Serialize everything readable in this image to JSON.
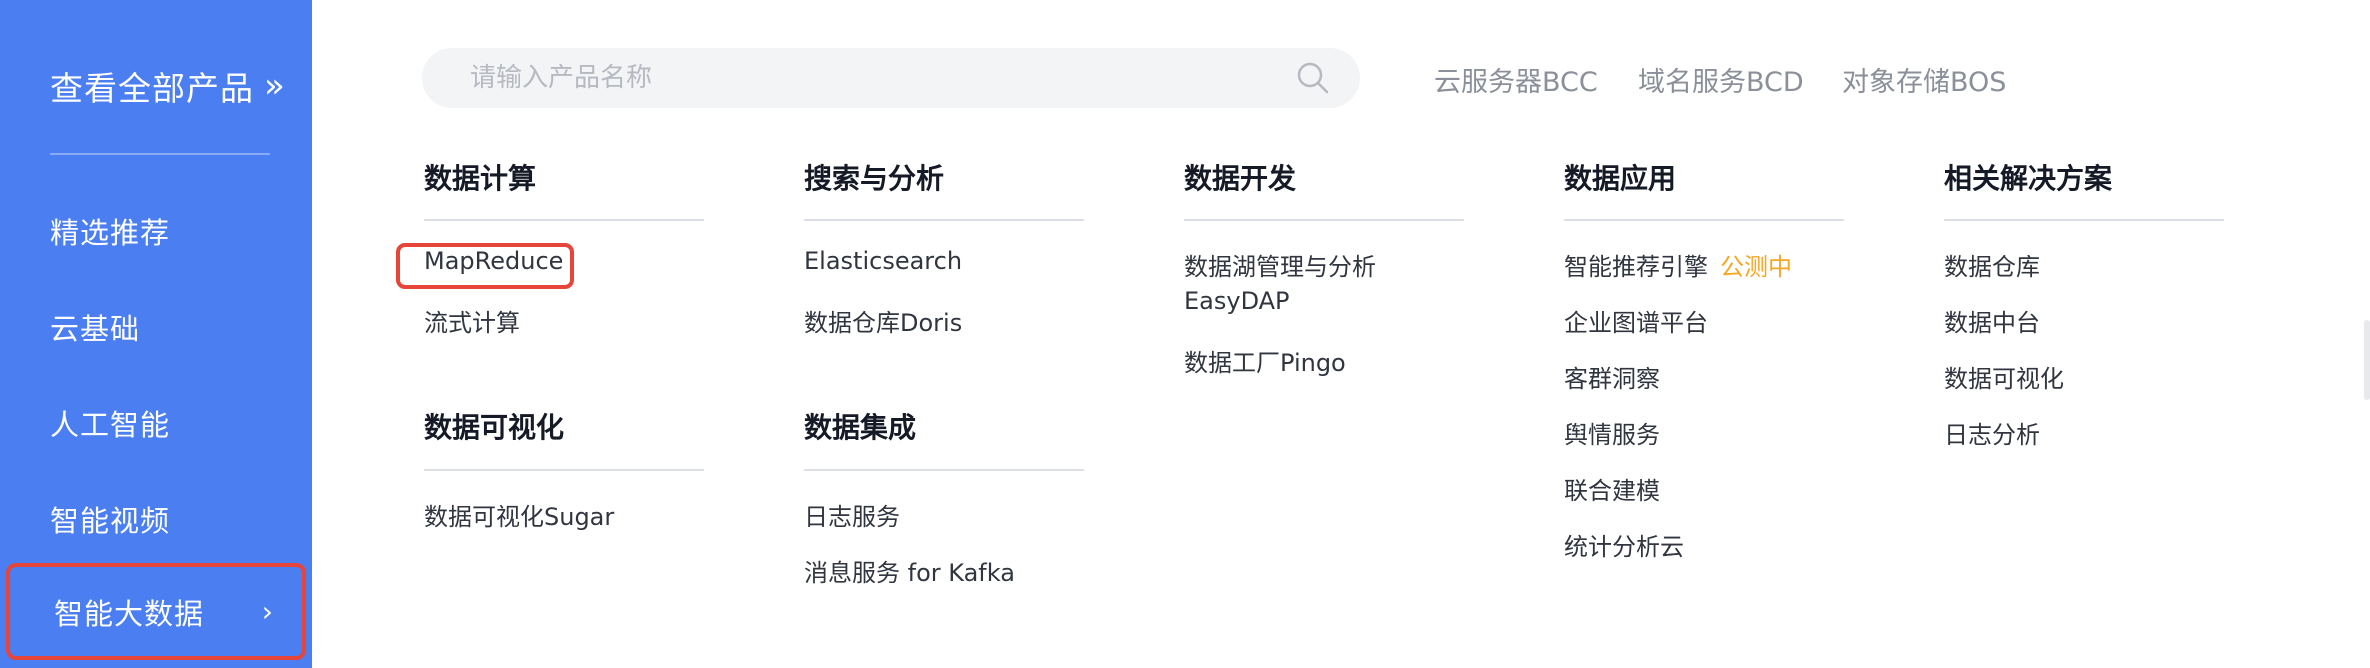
{
  "sidebar": {
    "all_products": "查看全部产品",
    "items": [
      {
        "label": "精选推荐"
      },
      {
        "label": "云基础"
      },
      {
        "label": "人工智能"
      },
      {
        "label": "智能视频"
      },
      {
        "label": "智能大数据"
      }
    ],
    "active_index": 4
  },
  "search": {
    "placeholder": "请输入产品名称",
    "value": ""
  },
  "quick_links": [
    "云服务器BCC",
    "域名服务BCD",
    "对象存储BOS"
  ],
  "categories": [
    {
      "title": "数据计算",
      "items": [
        "MapReduce",
        "流式计算"
      ]
    },
    {
      "title": "搜索与分析",
      "items": [
        "Elasticsearch",
        "数据仓库Doris"
      ]
    },
    {
      "title": "数据开发",
      "items": [
        "数据湖管理与分析",
        "EasyDAP",
        "数据工厂Pingo"
      ]
    },
    {
      "title": "数据应用",
      "items": [
        "智能推荐引擎",
        "企业图谱平台",
        "客群洞察",
        "舆情服务",
        "联合建模",
        "统计分析云"
      ],
      "badge": "公测中"
    },
    {
      "title": "相关解决方案",
      "items": [
        "数据仓库",
        "数据中台",
        "数据可视化",
        "日志分析"
      ]
    },
    {
      "title": "数据可视化",
      "items": [
        "数据可视化Sugar"
      ]
    },
    {
      "title": "数据集成",
      "items": [
        "日志服务",
        "消息服务 for Kafka"
      ]
    }
  ],
  "colors": {
    "sidebar_bg": "#4a7ef1",
    "highlight": "#e6453a",
    "badge": "#f5a623"
  },
  "icons": {
    "all_products": "double-chevron-right-icon",
    "active_item": "chevron-right-icon",
    "search": "search-icon"
  }
}
